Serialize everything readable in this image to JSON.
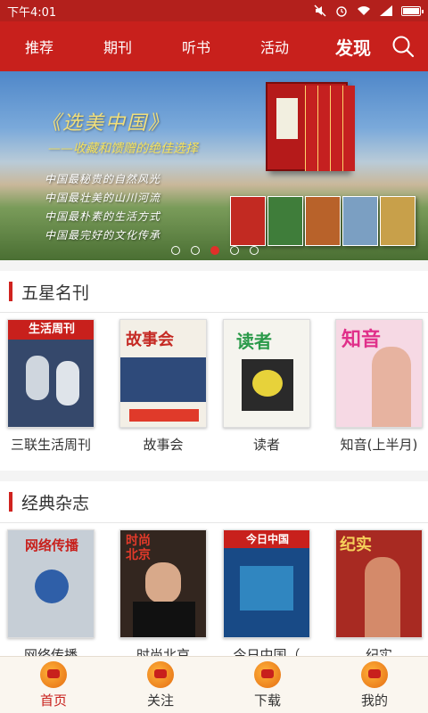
{
  "status": {
    "time": "下午4:01"
  },
  "nav": {
    "tabs": [
      "推荐",
      "期刊",
      "听书",
      "活动",
      "发现"
    ],
    "active_index": 4
  },
  "banner": {
    "title": "《选美中国》",
    "subtitle": "——收藏和馈赠的绝佳选择",
    "lines": [
      "中国最秘贵的自然风光",
      "中国最壮美的山川河流",
      "中国最朴素的生活方式",
      "中国最完好的文化传承"
    ],
    "slide_count": 5,
    "active_slide": 2
  },
  "sections": [
    {
      "title": "五星名刊",
      "items": [
        {
          "name": "三联生活周刊",
          "cover_color": "#2a3a5a"
        },
        {
          "name": "故事会",
          "cover_color": "#c52a24"
        },
        {
          "name": "读者",
          "cover_color": "#f2f1ea"
        },
        {
          "name": "知音(上半月)",
          "cover_color": "#e06aa0"
        }
      ]
    },
    {
      "title": "经典杂志",
      "items": [
        {
          "name": "网络传播",
          "cover_color": "#b8c2cc"
        },
        {
          "name": "时尚北京",
          "cover_color": "#3a2a22"
        },
        {
          "name": "今日中国（",
          "cover_color": "#1c4e8a"
        },
        {
          "name": "纪实",
          "cover_color": "#b42a22"
        }
      ]
    }
  ],
  "cover_texts": {
    "sanlian": "生活周刊",
    "gushihui": "故事会",
    "duzhe": "读者",
    "zhiyin": "知音",
    "wangluo": "网络传播",
    "shishang": "时尚北京",
    "jinri": "今日中国",
    "jishi": "纪实"
  },
  "bottom_nav": [
    {
      "label": "首页",
      "icon": "home-icon"
    },
    {
      "label": "关注",
      "icon": "follow-icon"
    },
    {
      "label": "下载",
      "icon": "download-icon"
    },
    {
      "label": "我的",
      "icon": "profile-icon"
    }
  ],
  "colors": {
    "brand_red": "#c8201c",
    "accent_bar": "#d0231f",
    "dot_active": "#e0302a"
  }
}
